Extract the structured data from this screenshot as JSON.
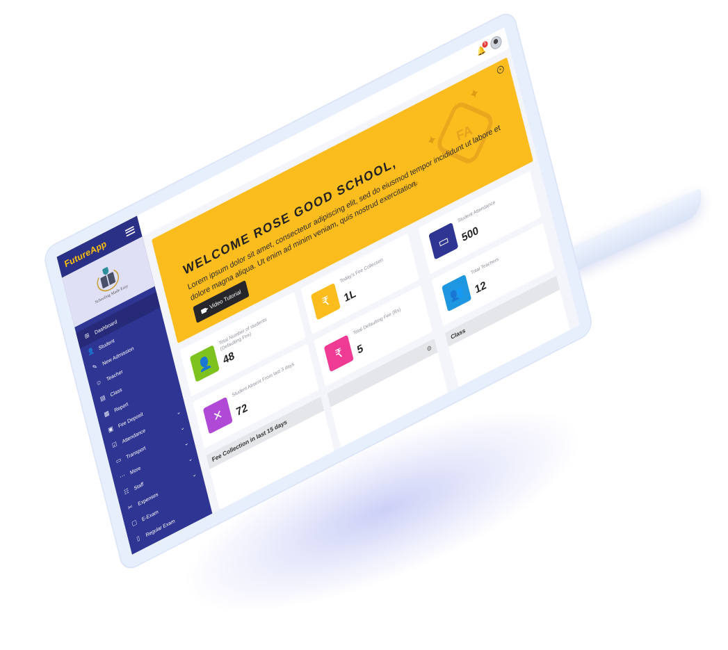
{
  "sidebar": {
    "brand": "FutureApp",
    "school_caption": "Schooling Made Easy",
    "items": [
      {
        "label": "Dashboard",
        "icon": "dashboard-icon",
        "glyph": "⊞",
        "chevron": ""
      },
      {
        "label": "Student",
        "icon": "student-icon",
        "glyph": "👤",
        "chevron": ""
      },
      {
        "label": "New Admission",
        "icon": "admission-icon",
        "glyph": "✎",
        "chevron": ""
      },
      {
        "label": "Teacher",
        "icon": "teacher-icon",
        "glyph": "☺",
        "chevron": ""
      },
      {
        "label": "Class",
        "icon": "class-icon",
        "glyph": "▤",
        "chevron": ""
      },
      {
        "label": "Report",
        "icon": "report-icon",
        "glyph": "▦",
        "chevron": ""
      },
      {
        "label": "Fee Deposit",
        "icon": "fee-deposit-icon",
        "glyph": "▣",
        "chevron": ""
      },
      {
        "label": "Attendance",
        "icon": "attendance-icon",
        "glyph": "☑",
        "chevron": "⌄"
      },
      {
        "label": "Transport",
        "icon": "transport-icon",
        "glyph": "▭",
        "chevron": "⌄"
      },
      {
        "label": "More",
        "icon": "more-icon",
        "glyph": "⋯",
        "chevron": "⌄"
      },
      {
        "label": "Staff",
        "icon": "staff-icon",
        "glyph": "☷",
        "chevron": "⌄"
      },
      {
        "label": "Expenses",
        "icon": "expenses-icon",
        "glyph": "✂",
        "chevron": "⌄"
      },
      {
        "label": "E-Exam",
        "icon": "e-exam-icon",
        "glyph": "▢",
        "chevron": ""
      },
      {
        "label": "Regular Exam",
        "icon": "regular-exam-icon",
        "glyph": "▯",
        "chevron": ""
      }
    ]
  },
  "topbar": {
    "notification_count": "3"
  },
  "banner": {
    "welcome": "WELCOME  ROSE GOOD SCHOOL,",
    "text": "Lorem ipsum dolor sit amet, consectetur adipiscing elit, sed do eiusmod tempor incididunt ut labore et dolore magna aliqua. Ut enim ad minim veniam, quis nostrud exercitation.",
    "button": "Video Tutorial",
    "badge_text": "FA"
  },
  "cards": [
    {
      "label": "Today's Fee Collection",
      "value": "1L",
      "color": "#fbbc1e",
      "icon": "rupee-icon",
      "glyph": "₹"
    },
    {
      "label": "Student Attendance",
      "value": "500",
      "color": "#2f3592",
      "icon": "monitor-icon",
      "glyph": "▭"
    },
    {
      "label": "Total Teachers",
      "value": "12",
      "color": "#1e96e0",
      "icon": "users-icon",
      "glyph": "👥"
    },
    {
      "label": "Total Number of students (Defaulting Fee)",
      "value": "48",
      "color": "#7dc21e",
      "icon": "user-icon",
      "glyph": "👤"
    },
    {
      "label": "Total Defaulting Fee (Rs)",
      "value": "5",
      "color": "#ef3b94",
      "icon": "money-icon",
      "glyph": "₹"
    },
    {
      "label": "Student Absent From last 3 days",
      "value": "72",
      "color": "#b04ad6",
      "icon": "calendar-x-icon",
      "glyph": "✕"
    }
  ],
  "panels": {
    "class_title": "Class",
    "fee_title": "Fee Collection in last 15 days"
  }
}
